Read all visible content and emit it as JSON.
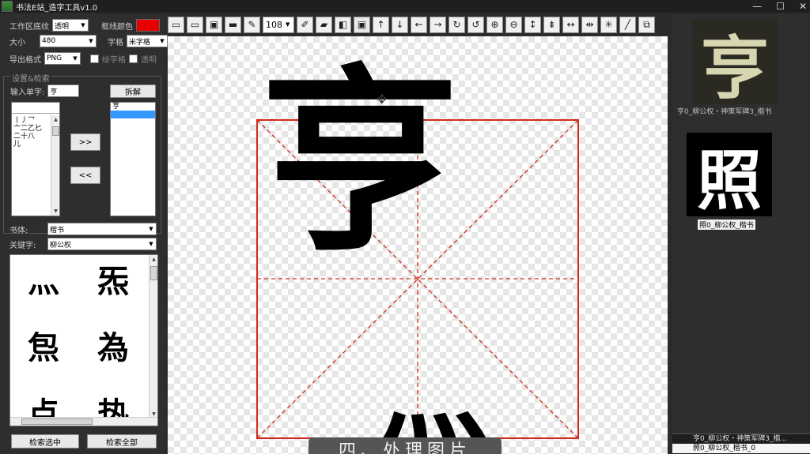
{
  "window": {
    "title": "书法E站_造字工具v1.0",
    "minimize": "—",
    "maximize": "☐",
    "close": "✕"
  },
  "settings": {
    "bg_label": "工作区底纹",
    "bg_value": "透明",
    "frame_color_label": "框线颜色",
    "frame_color": "#e60000",
    "size_label": "大小",
    "size_value": "480",
    "grid_label": "字格",
    "grid_value": "米字格",
    "export_label": "导出格式",
    "export_value": "PNG",
    "draw_grid_label": "绘字格",
    "transparent_label": "透明"
  },
  "search_group": {
    "title": "设置&检索",
    "input_label": "输入单字:",
    "input_value": "亨",
    "split_button": "拆解",
    "components": [
      "丨丿乛",
      "亠二乙匕",
      "二十八",
      "儿"
    ],
    "add_button": ">>",
    "remove_button": "<<",
    "selected_list": [
      "亨",
      ""
    ]
  },
  "font_label": "书体:",
  "font_value": "楷书",
  "keyword_label": "关键字:",
  "keyword_value": "柳公权",
  "gallery": [
    "灬",
    "炁",
    "炰",
    "為",
    "点",
    "热"
  ],
  "search_selected_button": "检索选中",
  "search_all_button": "检索全部",
  "toolbar": {
    "zoom_value": "108",
    "icons": [
      "open-folder-icon",
      "open-icon",
      "image-icon",
      "save-icon",
      "edit-icon",
      "zoom-combo",
      "brush-icon",
      "eraser-icon",
      "layer-icon",
      "frame-icon",
      "arrow-up-icon",
      "arrow-down-icon",
      "arrow-left-icon",
      "arrow-right-icon",
      "rotate-cw-icon",
      "rotate-ccw-icon",
      "zoom-in-icon",
      "zoom-out-icon",
      "flip-vertical-icon",
      "compress-vertical-icon",
      "flip-horizontal-icon",
      "compress-horizontal-icon",
      "center-icon",
      "pen-icon",
      "export-icon"
    ]
  },
  "canvas": {
    "char_top": "亨",
    "char_bottom": "灬",
    "caption": "四、处理图片"
  },
  "right_panel": {
    "thumb1_char": "亨",
    "thumb1_caption": "亨0_柳公权・神策军碑3_楷书",
    "thumb2_char": "照",
    "thumb2_caption": "照0_柳公权_楷书",
    "results": [
      "亨0_柳公权・神策军碑3_楷...",
      "照0_柳公权_楷书_0"
    ]
  }
}
